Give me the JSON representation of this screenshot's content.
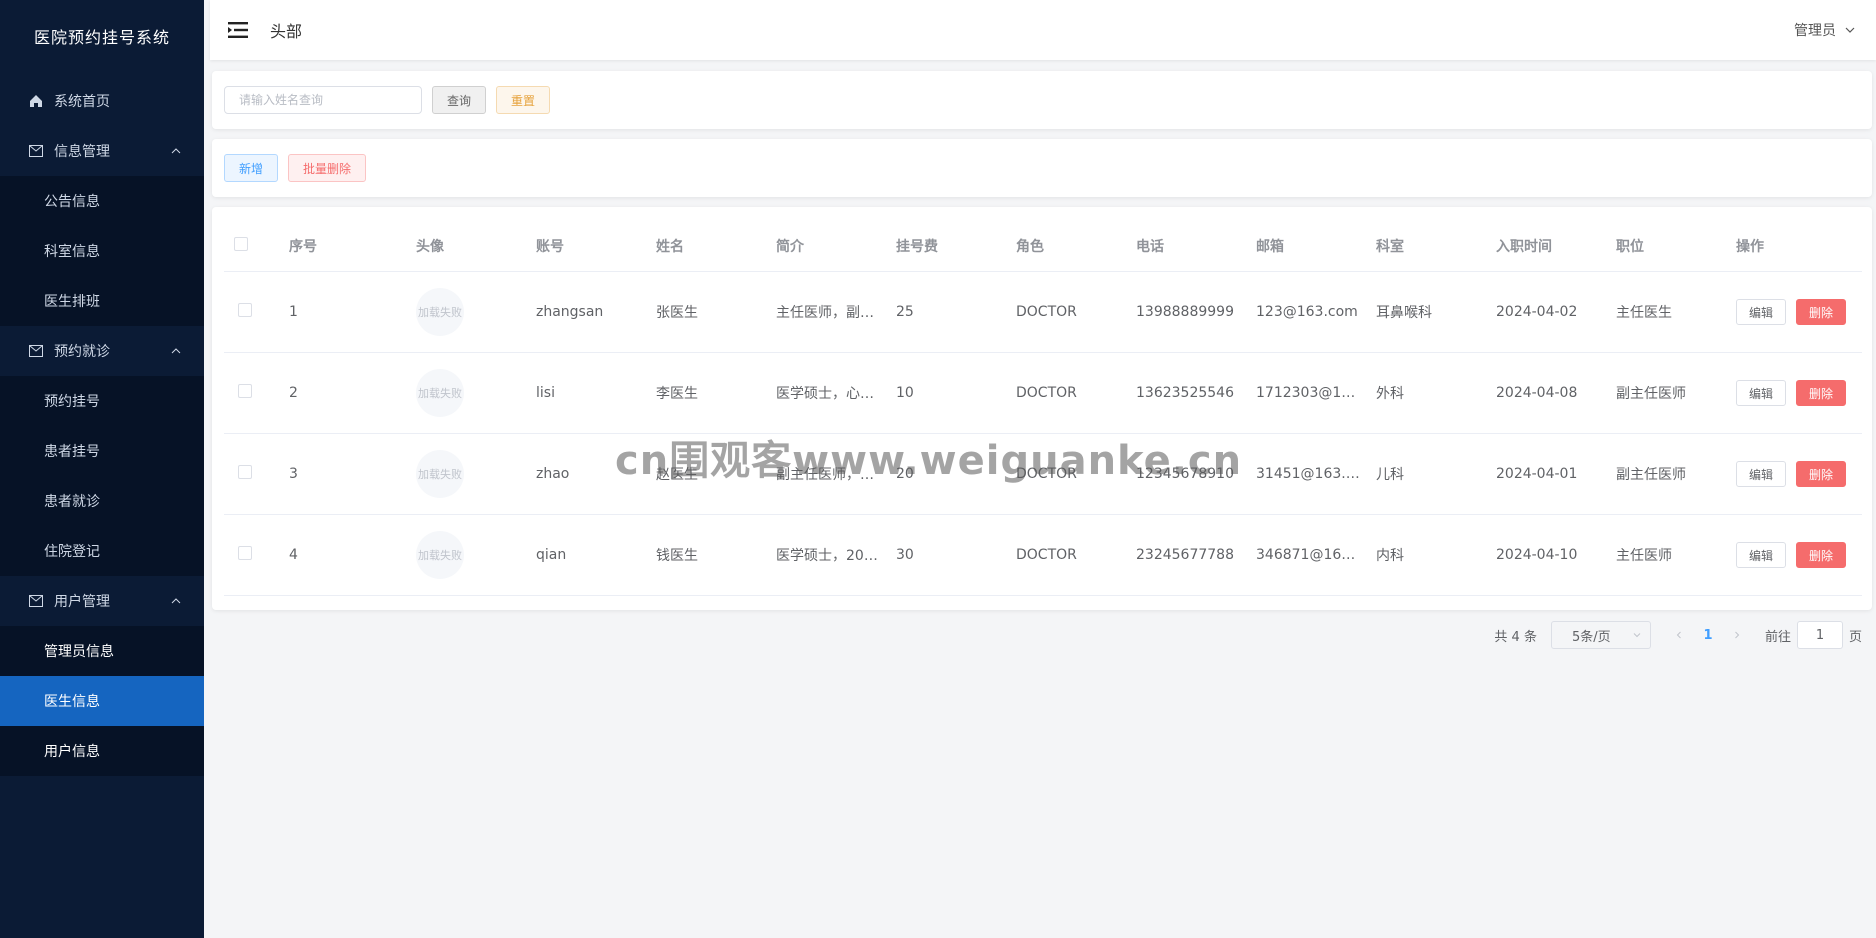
{
  "app": {
    "title": "医院预约挂号系统"
  },
  "sidebar": {
    "home": "系统首页",
    "groups": [
      {
        "label": "信息管理",
        "items": [
          "公告信息",
          "科室信息",
          "医生排班"
        ]
      },
      {
        "label": "预约就诊",
        "items": [
          "预约挂号",
          "患者挂号",
          "患者就诊",
          "住院登记"
        ]
      },
      {
        "label": "用户管理",
        "items": [
          "管理员信息",
          "医生信息",
          "用户信息"
        ]
      }
    ],
    "active_item": "医生信息"
  },
  "header": {
    "title": "头部",
    "user": "管理员"
  },
  "search": {
    "placeholder": "请输入姓名查询",
    "query_label": "查询",
    "reset_label": "重置"
  },
  "actions": {
    "add_label": "新增",
    "batch_delete_label": "批量删除"
  },
  "table": {
    "columns": [
      "序号",
      "头像",
      "账号",
      "姓名",
      "简介",
      "挂号费",
      "角色",
      "电话",
      "邮箱",
      "科室",
      "入职时间",
      "职位",
      "操作"
    ],
    "avatar_fallback": "加载失败",
    "edit_label": "编辑",
    "delete_label": "删除",
    "rows": [
      {
        "id": "1",
        "account": "zhangsan",
        "name": "张医生",
        "intro": "主任医师，副…",
        "fee": "25",
        "role": "DOCTOR",
        "phone": "13988889999",
        "email": "123@163.com",
        "dept": "耳鼻喉科",
        "date": "2024-04-02",
        "position": "主任医生"
      },
      {
        "id": "2",
        "account": "lisi",
        "name": "李医生",
        "intro": "医学硕士，心…",
        "fee": "10",
        "role": "DOCTOR",
        "phone": "13623525546",
        "email": "1712303@1…",
        "dept": "外科",
        "date": "2024-04-08",
        "position": "副主任医师"
      },
      {
        "id": "3",
        "account": "zhao",
        "name": "赵医生",
        "intro": "副主任医师，…",
        "fee": "20",
        "role": "DOCTOR",
        "phone": "12345678910",
        "email": "31451@163.…",
        "dept": "儿科",
        "date": "2024-04-01",
        "position": "副主任医师"
      },
      {
        "id": "4",
        "account": "qian",
        "name": "钱医生",
        "intro": "医学硕士，20…",
        "fee": "30",
        "role": "DOCTOR",
        "phone": "23245677788",
        "email": "346871@16…",
        "dept": "内科",
        "date": "2024-04-10",
        "position": "主任医师"
      }
    ]
  },
  "pagination": {
    "total": "共 4 条",
    "page_size": "5条/页",
    "current_page": "1",
    "goto_label": "前往",
    "goto_value": "1",
    "page_suffix": "页"
  },
  "watermark": "cn围观客www.weiguanke.cn",
  "colors": {
    "sidebar_bg": "#0b1b35",
    "active": "#1565c0",
    "danger": "#f56c6c",
    "primary": "#409eff"
  }
}
